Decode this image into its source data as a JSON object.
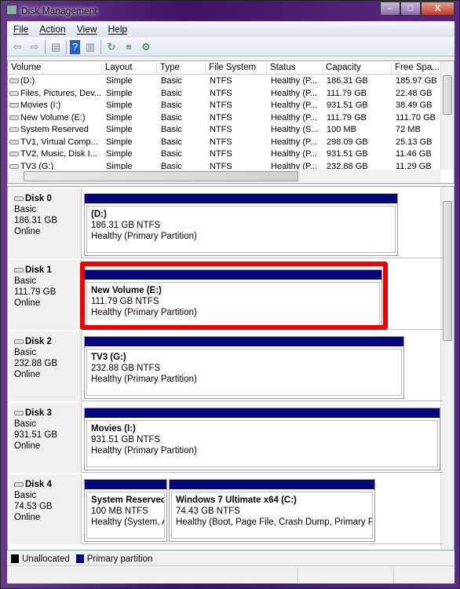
{
  "window": {
    "title": "Disk Management",
    "minimize": "–",
    "maximize": "□",
    "close": "X"
  },
  "menu": [
    "File",
    "Action",
    "View",
    "Help"
  ],
  "toolbar": [
    {
      "name": "back-icon",
      "glyph": "⇦"
    },
    {
      "name": "forward-icon",
      "glyph": "⇨"
    },
    {
      "name": "console-tree-icon",
      "glyph": "▤"
    },
    {
      "name": "help-icon",
      "glyph": "?"
    },
    {
      "name": "action-pane-icon",
      "glyph": "▥"
    },
    {
      "name": "refresh-icon",
      "glyph": "↻"
    },
    {
      "name": "properties-icon",
      "glyph": "≡"
    },
    {
      "name": "settings-icon",
      "glyph": "⚙"
    }
  ],
  "volume_list": {
    "columns": [
      "Volume",
      "Layout",
      "Type",
      "File System",
      "Status",
      "Capacity",
      "Free Spa..."
    ],
    "rows": [
      [
        "(D:)",
        "Simple",
        "Basic",
        "NTFS",
        "Healthy (P...",
        "186.31 GB",
        "185.97 GB"
      ],
      [
        "Files, Pictures, Dev...",
        "Simple",
        "Basic",
        "NTFS",
        "Healthy (P...",
        "111.79 GB",
        "22.48 GB"
      ],
      [
        "Movies (I:)",
        "Simple",
        "Basic",
        "NTFS",
        "Healthy (P...",
        "931.51 GB",
        "38.49 GB"
      ],
      [
        "New Volume (E:)",
        "Simple",
        "Basic",
        "NTFS",
        "Healthy (P...",
        "111.79 GB",
        "111.70 GB"
      ],
      [
        "System Reserved",
        "Simple",
        "Basic",
        "NTFS",
        "Healthy (S...",
        "100 MB",
        "72 MB"
      ],
      [
        "TV1, Virtual Comp...",
        "Simple",
        "Basic",
        "NTFS",
        "Healthy (P...",
        "298.09 GB",
        "25.13 GB"
      ],
      [
        "TV2, Music, Disk I...",
        "Simple",
        "Basic",
        "NTFS",
        "Healthy (P...",
        "931.51 GB",
        "11.46 GB"
      ],
      [
        "TV3 (G:)",
        "Simple",
        "Basic",
        "NTFS",
        "Healthy (P...",
        "232.88 GB",
        "11.29 GB"
      ]
    ]
  },
  "disks": [
    {
      "name": "Disk 0",
      "type": "Basic",
      "size": "186.31 GB",
      "state": "Online",
      "partitions": [
        {
          "title": "(D:)",
          "size": "186.31 GB NTFS",
          "status": "Healthy (Primary Partition)"
        }
      ]
    },
    {
      "name": "Disk 1",
      "type": "Basic",
      "size": "111.79 GB",
      "state": "Online",
      "partitions": [
        {
          "title": "New Volume  (E:)",
          "size": "111.79 GB NTFS",
          "status": "Healthy (Primary Partition)"
        }
      ]
    },
    {
      "name": "Disk 2",
      "type": "Basic",
      "size": "232.88 GB",
      "state": "Online",
      "partitions": [
        {
          "title": "TV3  (G:)",
          "size": "232.88 GB NTFS",
          "status": "Healthy (Primary Partition)"
        }
      ]
    },
    {
      "name": "Disk 3",
      "type": "Basic",
      "size": "931.51 GB",
      "state": "Online",
      "partitions": [
        {
          "title": "Movies  (I:)",
          "size": "931.51 GB NTFS",
          "status": "Healthy (Primary Partition)"
        }
      ]
    },
    {
      "name": "Disk 4",
      "type": "Basic",
      "size": "74.53 GB",
      "state": "Online",
      "partitions": [
        {
          "title": "System Reserved",
          "size": "100 MB NTFS",
          "status": "Healthy (System, A"
        },
        {
          "title": "Windows 7 Ultimate x64  (C:)",
          "size": "74.43 GB NTFS",
          "status": "Healthy (Boot, Page File, Crash Dump, Primary Parti"
        }
      ]
    }
  ],
  "highlighted_disk": "Disk 1",
  "legend": [
    {
      "label": "Unallocated",
      "color": "#000000"
    },
    {
      "label": "Primary partition",
      "color": "#06067a"
    }
  ],
  "colors": {
    "primary_partition": "#06067a",
    "highlight": "#ee0000"
  }
}
